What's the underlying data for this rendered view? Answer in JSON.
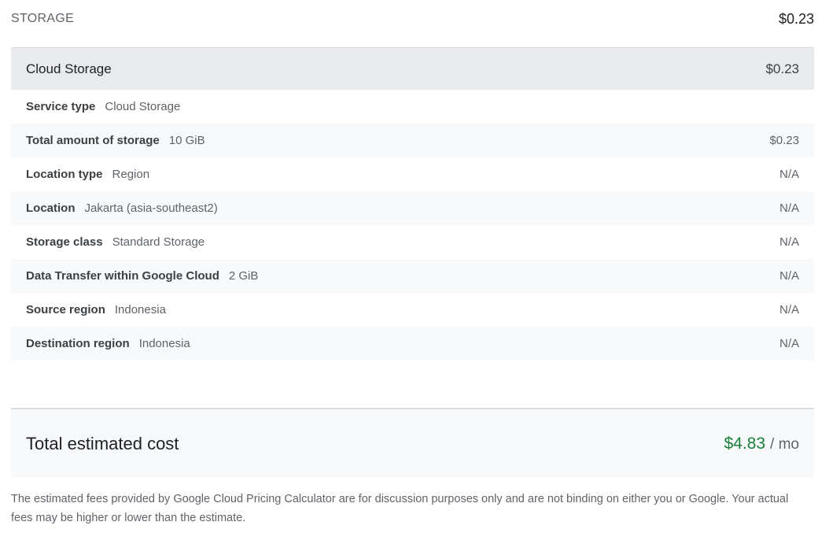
{
  "section": {
    "title": "STORAGE",
    "total": "$0.23"
  },
  "service": {
    "name": "Cloud Storage",
    "cost": "$0.23",
    "rows": [
      {
        "label": "Service type",
        "value": "Cloud Storage",
        "cost": ""
      },
      {
        "label": "Total amount of storage",
        "value": "10 GiB",
        "cost": "$0.23"
      },
      {
        "label": "Location type",
        "value": "Region",
        "cost": "N/A"
      },
      {
        "label": "Location",
        "value": "Jakarta (asia-southeast2)",
        "cost": "N/A"
      },
      {
        "label": "Storage class",
        "value": "Standard Storage",
        "cost": "N/A"
      },
      {
        "label": "Data Transfer within Google Cloud",
        "value": "2 GiB",
        "cost": "N/A"
      },
      {
        "label": "Source region",
        "value": "Indonesia",
        "cost": "N/A"
      },
      {
        "label": "Destination region",
        "value": "Indonesia",
        "cost": "N/A"
      }
    ]
  },
  "total": {
    "label": "Total estimated cost",
    "amount": "$4.83",
    "period": "/ mo",
    "amount_color": "#188038"
  },
  "disclaimer": "The estimated fees provided by Google Cloud Pricing Calculator are for discussion purposes only and are not binding on either you or Google. Your actual fees may be higher or lower than the estimate."
}
